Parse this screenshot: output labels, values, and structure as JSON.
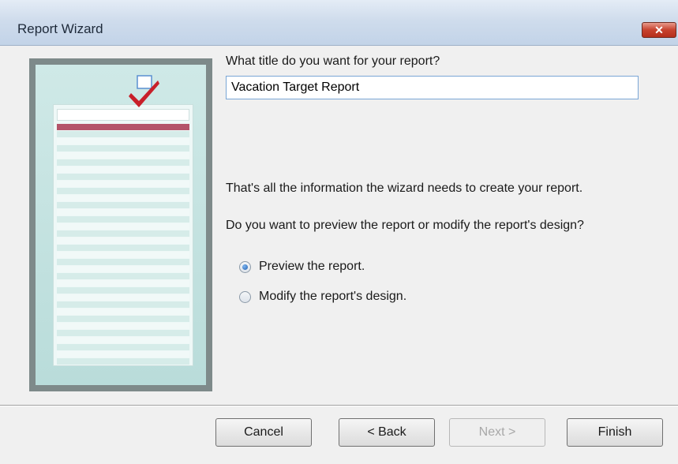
{
  "window": {
    "title": "Report Wizard",
    "close_label": "✕"
  },
  "preview": {
    "image_icon": "report-preview-image",
    "check_icon": "checkmark-icon"
  },
  "form": {
    "title_prompt": "What title do you want for your report?",
    "title_value": "Vacation Target Report",
    "info_text": "That's all the information the wizard needs to create your report.",
    "question_text": "Do you want to preview the report or modify the report's design?",
    "options": [
      {
        "label": "Preview the report.",
        "selected": true
      },
      {
        "label": "Modify the report's design.",
        "selected": false
      }
    ]
  },
  "buttons": {
    "cancel": "Cancel",
    "back": "< Back",
    "next": "Next >",
    "finish": "Finish"
  },
  "colors": {
    "accent": "#c7422e",
    "selection": "#1f5fb0"
  }
}
